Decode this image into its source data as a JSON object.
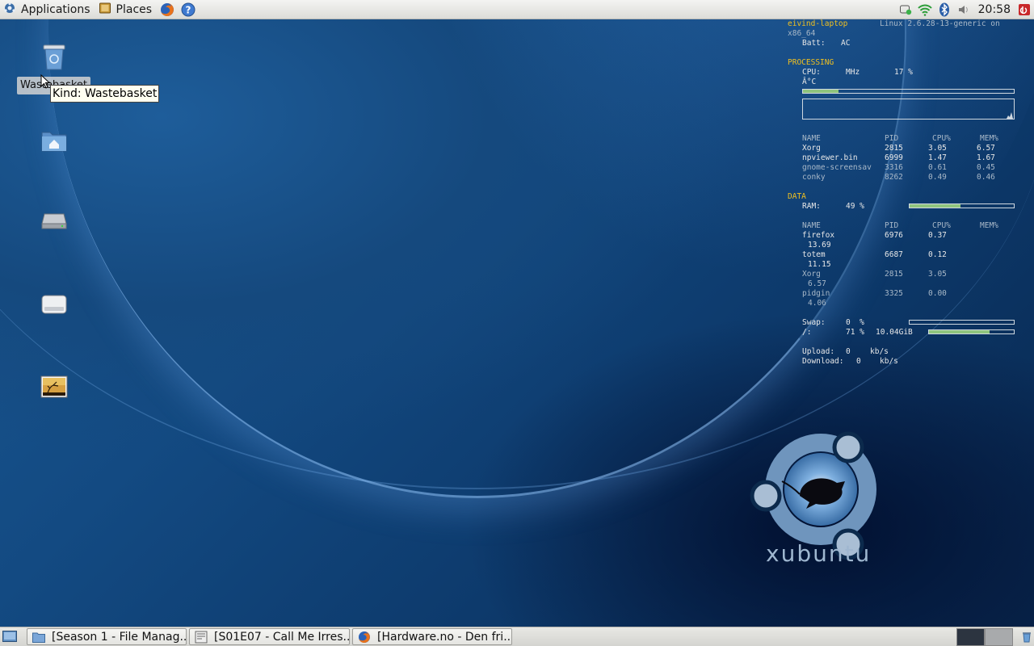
{
  "top_panel": {
    "applications_label": "Applications",
    "places_label": "Places",
    "clock": "20:58",
    "launchers": [
      "firefox-icon",
      "help-icon"
    ],
    "tray": [
      "notification-icon",
      "wifi-icon",
      "bluetooth-icon",
      "volume-icon",
      "logout-icon"
    ]
  },
  "desktop": {
    "icons": [
      "wastebasket-icon",
      "home-folder-icon",
      "hard-drive-icon",
      "removable-drive-icon",
      "image-file-icon"
    ],
    "selected_icon_label": "Wastebasket",
    "tooltip": "Kind: Wastebasket"
  },
  "conky": {
    "hostname": "eivind-laptop",
    "kernel": "Linux 2.6.28-13-generic on",
    "arch": "x86_64",
    "batt_label": "Batt:",
    "batt_value": "AC",
    "processing_header": "PROCESSING",
    "cpu_label": "CPU:",
    "cpu_mhz_label": "MHz",
    "cpu_pct": "17 %",
    "cpu_bar_fraction": 0.17,
    "temp": "Â°C",
    "proc_headers": [
      "NAME",
      "PID",
      "CPU%",
      "MEM%"
    ],
    "cpu_top": [
      [
        "Xorg",
        "2815",
        "3.05",
        "6.57"
      ],
      [
        "npviewer.bin",
        "6999",
        "1.47",
        "1.67"
      ],
      [
        "gnome-screensav",
        "3316",
        "0.61",
        "0.45"
      ],
      [
        "conky",
        "8262",
        "0.49",
        "0.46"
      ]
    ],
    "data_header": "DATA",
    "ram_label": "RAM:",
    "ram_pct": "49 %",
    "ram_bar_fraction": 0.49,
    "mem_top": [
      {
        "name": "firefox",
        "pid": "6976",
        "cpu": "0.37",
        "mem": "13.69"
      },
      {
        "name": "totem",
        "pid": "6687",
        "cpu": "0.12",
        "mem": "11.15"
      },
      {
        "name": "Xorg",
        "pid": "2815",
        "cpu": "3.05",
        "mem": "6.57"
      },
      {
        "name": "pidgin",
        "pid": "3325",
        "cpu": "0.00",
        "mem": "4.06"
      }
    ],
    "swap_label": "Swap:",
    "swap_pct": "0  %",
    "swap_bar_fraction": 0.0,
    "root_label": "/:",
    "root_pct": "71 %",
    "root_size": "10.04GiB",
    "root_bar_fraction": 0.71,
    "upload_label": "Upload:",
    "upload_value": "0",
    "upload_unit": "kb/s",
    "download_label": "Download:",
    "download_value": "0",
    "download_unit": "kb/s"
  },
  "logo_text": "xubuntu",
  "taskbar": {
    "tasks": [
      {
        "label": "[Season 1 - File Manag...",
        "icon": "folder-icon"
      },
      {
        "label": "[S01E07 - Call Me Irres...",
        "icon": "video-player-icon"
      },
      {
        "label": "[Hardware.no - Den fri...",
        "icon": "firefox-icon"
      }
    ]
  },
  "colors": {
    "conky_header": "#f0c020",
    "conky_bar": "#8fc47e",
    "desktop_blue": "#134a82"
  }
}
